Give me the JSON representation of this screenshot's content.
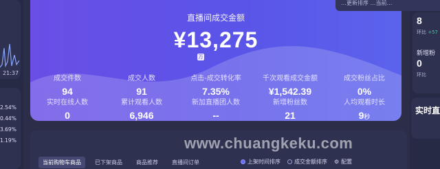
{
  "left": {
    "time": "21:37",
    "percents": [
      "2.54%",
      "0.44%",
      "3.69%",
      "1.19%"
    ]
  },
  "top_tip": "…更新排序   …当前…",
  "main": {
    "title": "直播间成交金额",
    "value": "¥13,275",
    "mini_icon": "万",
    "stats": [
      {
        "label": "成交件数",
        "value": "94"
      },
      {
        "label": "成交人数",
        "value": "91"
      },
      {
        "label": "点击-成交转化率",
        "value": "7.35%"
      },
      {
        "label": "千次观看成交金额",
        "value": "¥1,542.39"
      },
      {
        "label": "成交粉丝占比",
        "value": "0%"
      },
      {
        "label": "实时在线人数",
        "value": "0"
      },
      {
        "label": "累计观看人数",
        "value": "6,946"
      },
      {
        "label": "新加直播团人数",
        "value": "--"
      },
      {
        "label": "新增粉丝数",
        "value": "21"
      },
      {
        "label": "人均观看时长",
        "value": "9",
        "unit": "秒"
      }
    ]
  },
  "right": {
    "value_1": "8",
    "change_1_label": "环比",
    "change_1_value": "+57",
    "label_2": "新增粉",
    "value_2": "0",
    "change_2_label": "环比",
    "realtime_title": "实时直"
  },
  "products": {
    "tabs": [
      "当前购物车商品",
      "已下架商品",
      "商品推荐",
      "直播间订单"
    ],
    "sorts": [
      {
        "label": "上架时间排序",
        "selected": true
      },
      {
        "label": "成交金额排序",
        "selected": false
      },
      {
        "label": "配置",
        "selected": false
      }
    ]
  },
  "watermark": "www.chuangkeku.com",
  "colors": {
    "card_gradient_start": "#6a4ee6",
    "card_gradient_end": "#5b63ec",
    "background": "#2b2d49",
    "accent_green": "#36d399"
  }
}
